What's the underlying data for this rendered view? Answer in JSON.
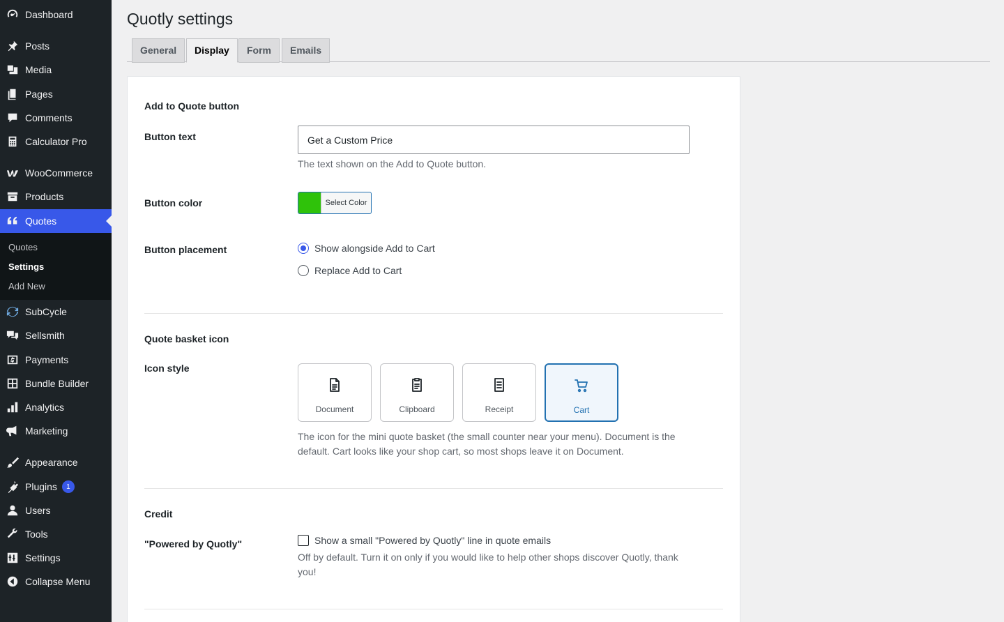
{
  "sidebar": {
    "items": [
      {
        "label": "Dashboard",
        "icon": "dashboard-icon"
      },
      {
        "label": "Posts",
        "icon": "pin-icon"
      },
      {
        "label": "Media",
        "icon": "media-icon"
      },
      {
        "label": "Pages",
        "icon": "pages-icon"
      },
      {
        "label": "Comments",
        "icon": "comment-icon"
      },
      {
        "label": "Calculator Pro",
        "icon": "calculator-icon"
      },
      {
        "label": "WooCommerce",
        "icon": "woocommerce-icon"
      },
      {
        "label": "Products",
        "icon": "archive-icon"
      },
      {
        "label": "Quotes",
        "icon": "quote-icon"
      },
      {
        "label": "SubCycle",
        "icon": "refresh-icon"
      },
      {
        "label": "Sellsmith",
        "icon": "chat-icon"
      },
      {
        "label": "Payments",
        "icon": "money-icon"
      },
      {
        "label": "Bundle Builder",
        "icon": "grid-icon"
      },
      {
        "label": "Analytics",
        "icon": "bar-chart-icon"
      },
      {
        "label": "Marketing",
        "icon": "megaphone-icon"
      },
      {
        "label": "Appearance",
        "icon": "brush-icon"
      },
      {
        "label": "Plugins",
        "icon": "plug-icon",
        "badge": "1"
      },
      {
        "label": "Users",
        "icon": "user-icon"
      },
      {
        "label": "Tools",
        "icon": "wrench-icon"
      },
      {
        "label": "Settings",
        "icon": "settings-icon"
      },
      {
        "label": "Collapse Menu",
        "icon": "collapse-icon"
      }
    ],
    "submenu": [
      {
        "label": "Quotes"
      },
      {
        "label": "Settings"
      },
      {
        "label": "Add New"
      }
    ],
    "active_color": "#3858e9"
  },
  "page": {
    "title": "Quotly settings",
    "tabs": [
      {
        "label": "General"
      },
      {
        "label": "Display"
      },
      {
        "label": "Form"
      },
      {
        "label": "Emails"
      }
    ],
    "active_tab": "Display"
  },
  "sections": {
    "add_to_quote": {
      "title": "Add to Quote button",
      "button_text": {
        "label": "Button text",
        "value": "Get a Custom Price",
        "description": "The text shown on the Add to Quote button."
      },
      "button_color": {
        "label": "Button color",
        "swatch": "#2fc20a",
        "picker_label": "Select Color"
      },
      "button_placement": {
        "label": "Button placement",
        "options": [
          {
            "label": "Show alongside Add to Cart",
            "checked": true
          },
          {
            "label": "Replace Add to Cart",
            "checked": false
          }
        ]
      }
    },
    "quote_basket": {
      "title": "Quote basket icon",
      "icon_style": {
        "label": "Icon style",
        "options": [
          {
            "label": "Document",
            "icon": "document-icon",
            "selected": false
          },
          {
            "label": "Clipboard",
            "icon": "clipboard-icon",
            "selected": false
          },
          {
            "label": "Receipt",
            "icon": "receipt-icon",
            "selected": false
          },
          {
            "label": "Cart",
            "icon": "cart-icon",
            "selected": true
          }
        ],
        "description_line1": "The icon for the mini quote basket (the small counter near your menu). Document is the",
        "description_line2": "default. Cart looks like your shop cart, so most shops leave it on Document."
      }
    },
    "credit": {
      "title": "Credit",
      "powered_by": {
        "label": "\"Powered by Quotly\"",
        "checkbox_label": "Show a small \"Powered by Quotly\" line in quote emails",
        "checked": false,
        "description_line1": "Off by default. Turn it on only if you would like to help other shops discover Quotly, thank",
        "description_line2": "you!"
      }
    }
  }
}
